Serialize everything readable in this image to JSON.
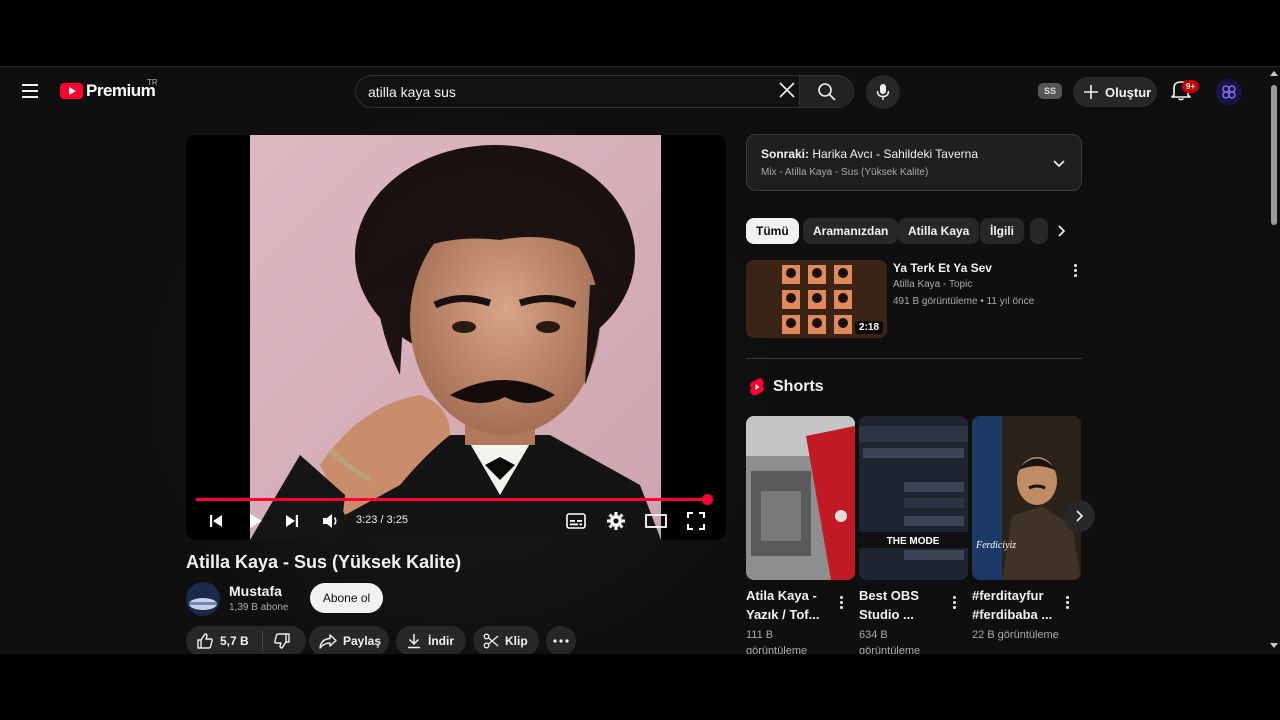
{
  "header": {
    "logo_text": "Premium",
    "country_code": "TR",
    "search_value": "atilla kaya sus",
    "ss_badge": "SS",
    "create_label": "Oluştur",
    "notif_count": "9+"
  },
  "player": {
    "time_display": "3:23 / 3:25",
    "progress_fraction": 0.99
  },
  "video": {
    "title": "Atilla Kaya - Sus (Yüksek Kalite)",
    "channel_name": "Mustafa",
    "subscribers": "1,39 B abone",
    "subscribe_label": "Abone ol",
    "like_count": "5,7 B",
    "share_label": "Paylaş",
    "download_label": "İndir",
    "clip_label": "Klip"
  },
  "upnext": {
    "prefix": "Sonraki:",
    "title": "Harika Avcı - Sahildeki Taverna",
    "playlist": "Mix - Atilla Kaya - Sus (Yüksek Kalite)"
  },
  "chips": [
    "Tümü",
    "Aramanızdan",
    "Atilla Kaya",
    "İlgili"
  ],
  "recommended": {
    "title": "Ya Terk Et Ya Sev",
    "channel": "Atilla Kaya - Topic",
    "meta": "491 B görüntüleme • 11 yıl önce",
    "duration": "2:18"
  },
  "shorts": {
    "heading": "Shorts",
    "items": [
      {
        "title": "Atila Kaya - Yazık / Tof...",
        "views": "111 B görüntüleme"
      },
      {
        "title": "Best OBS Studio ...",
        "views": "634 B görüntüleme",
        "thumb_caption": "THE MODE"
      },
      {
        "title": "#ferditayfur #ferdibaba ...",
        "views": "22 B görüntüleme",
        "thumb_caption": "Ferdiciyiz"
      }
    ]
  },
  "colors": {
    "accent": "#ff0033",
    "background": "#0f0f0f",
    "chip_bg": "#272727"
  }
}
